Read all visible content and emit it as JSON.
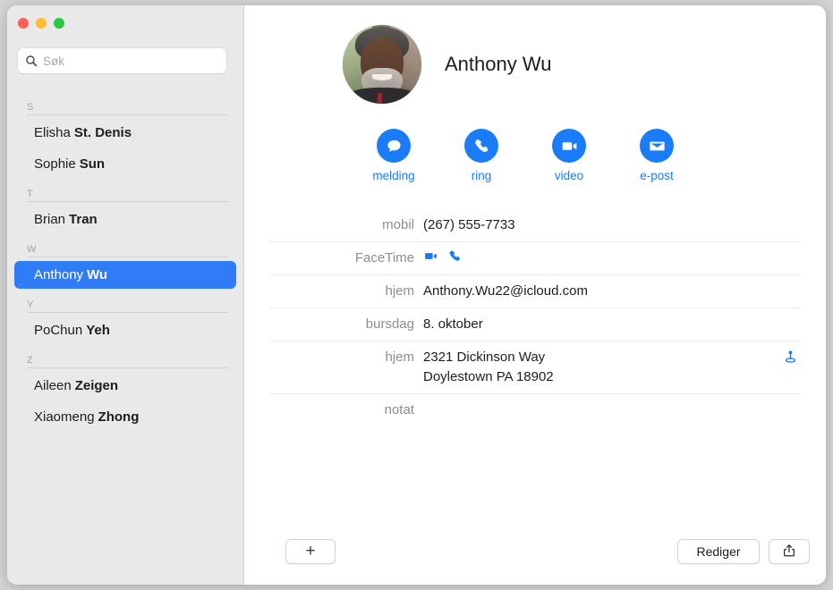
{
  "window": {
    "traffic_lights": [
      "close",
      "minimize",
      "zoom"
    ],
    "colors": {
      "accent_blue": "#2f7cf6",
      "action_blue": "#1a7cf8",
      "sidebar_bg": "#e9e9e9",
      "detail_bg": "#ffffff",
      "label_gray": "#8d8d92"
    }
  },
  "sidebar": {
    "search": {
      "placeholder": "Søk",
      "value": "",
      "icon": "search-icon"
    },
    "groups": [
      {
        "letter": "S",
        "contacts": [
          {
            "first": "Elisha",
            "last": "St. Denis",
            "selected": false
          },
          {
            "first": "Sophie",
            "last": "Sun",
            "selected": false
          }
        ]
      },
      {
        "letter": "T",
        "contacts": [
          {
            "first": "Brian",
            "last": "Tran",
            "selected": false
          }
        ]
      },
      {
        "letter": "W",
        "contacts": [
          {
            "first": "Anthony",
            "last": "Wu",
            "selected": true
          }
        ]
      },
      {
        "letter": "Y",
        "contacts": [
          {
            "first": "PoChun",
            "last": "Yeh",
            "selected": false
          }
        ]
      },
      {
        "letter": "Z",
        "contacts": [
          {
            "first": "Aileen",
            "last": "Zeigen",
            "selected": false
          },
          {
            "first": "Xiaomeng",
            "last": "Zhong",
            "selected": false
          }
        ]
      }
    ]
  },
  "detail": {
    "avatar_alt": "contact-photo",
    "name": "Anthony Wu",
    "actions": [
      {
        "label": "melding",
        "icon": "message-bubble-icon"
      },
      {
        "label": "ring",
        "icon": "phone-icon"
      },
      {
        "label": "video",
        "icon": "video-camera-icon"
      },
      {
        "label": "e-post",
        "icon": "envelope-icon"
      }
    ],
    "fields": [
      {
        "label": "mobil",
        "value": "(267) 555-7733",
        "type": "text"
      },
      {
        "label": "FaceTime",
        "value": "",
        "type": "icons",
        "icons": [
          "video-camera-icon",
          "phone-icon"
        ]
      },
      {
        "label": "hjem",
        "value": "Anthony.Wu22@icloud.com",
        "type": "text"
      },
      {
        "label": "bursdag",
        "value": "8. oktober",
        "type": "text"
      },
      {
        "label": "hjem",
        "value": "",
        "type": "address",
        "address_line1": "2321 Dickinson Way",
        "address_line2": "Doylestown PA 18902",
        "trailing_icon": "map-pin-icon"
      },
      {
        "label": "notat",
        "value": "",
        "type": "text"
      }
    ]
  },
  "bottom_bar": {
    "add_label": "+",
    "edit_label": "Rediger",
    "share_icon": "share-icon"
  }
}
